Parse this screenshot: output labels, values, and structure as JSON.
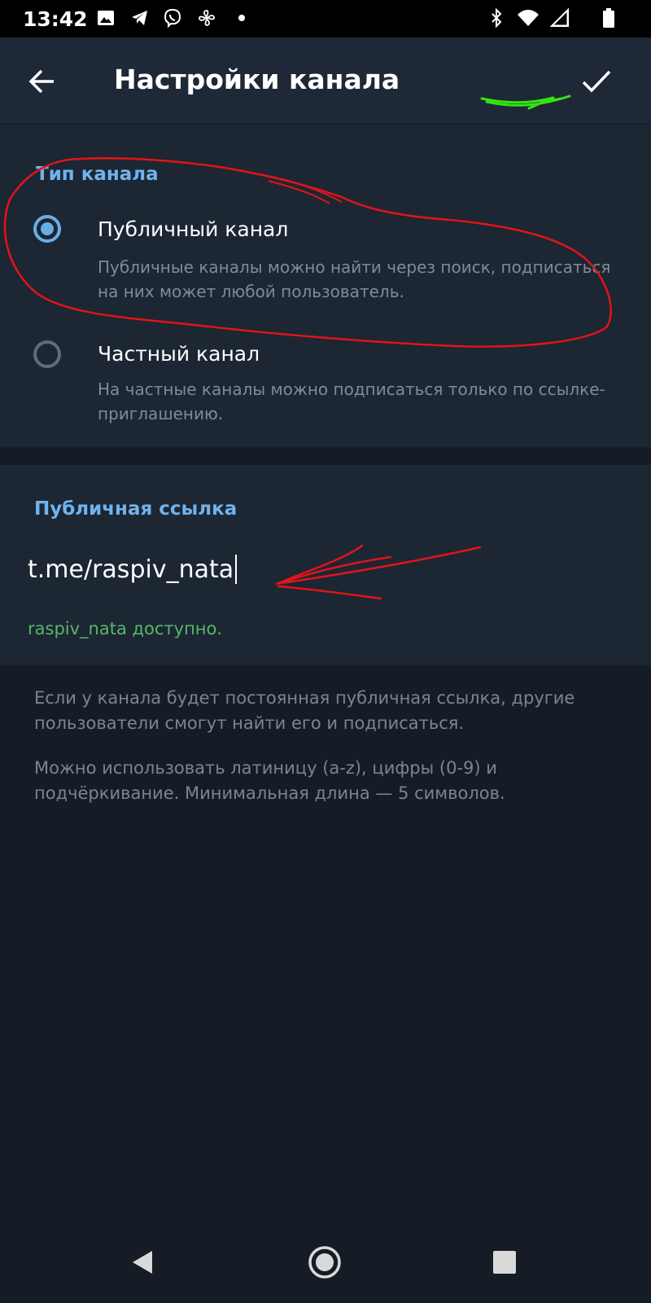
{
  "status_bar": {
    "time": "13:42",
    "left_icons": [
      "gallery-icon",
      "telegram-icon",
      "viber-icon",
      "fan-icon",
      "dot-icon"
    ],
    "right_icons": [
      "bluetooth-icon",
      "wifi-icon",
      "signal-icon",
      "battery-icon"
    ]
  },
  "app_bar": {
    "title": "Настройки канала",
    "back_icon": "arrow-left-icon",
    "confirm_icon": "check-icon"
  },
  "channel_type": {
    "header": "Тип канала",
    "options": [
      {
        "label": "Публичный канал",
        "description": "Публичные каналы можно найти через поиск, подписаться на них может любой пользователь.",
        "selected": true
      },
      {
        "label": "Частный канал",
        "description": "На частные каналы можно подписаться только по ссылке-приглашению.",
        "selected": false
      }
    ]
  },
  "public_link": {
    "header": "Публичная ссылка",
    "prefix": "t.me/",
    "value": "raspiv_nata",
    "availability": "raspiv_nata доступно."
  },
  "info": {
    "paragraph1": "Если у канала будет постоянная публичная ссылка, другие пользователи смогут найти его и подписаться.",
    "paragraph2": "Можно использовать латиницу (a-z), цифры (0-9) и подчёркивание. Минимальная длина — 5 символов."
  },
  "nav_bar": {
    "icons": [
      "back-triangle-icon",
      "home-circle-icon",
      "recents-square-icon"
    ]
  },
  "colors": {
    "accent": "#67aee9",
    "available": "#57b769",
    "background": "#151c26",
    "surface": "#1d2633",
    "annotation_red": "#e0141a",
    "annotation_green": "#33e40f"
  }
}
